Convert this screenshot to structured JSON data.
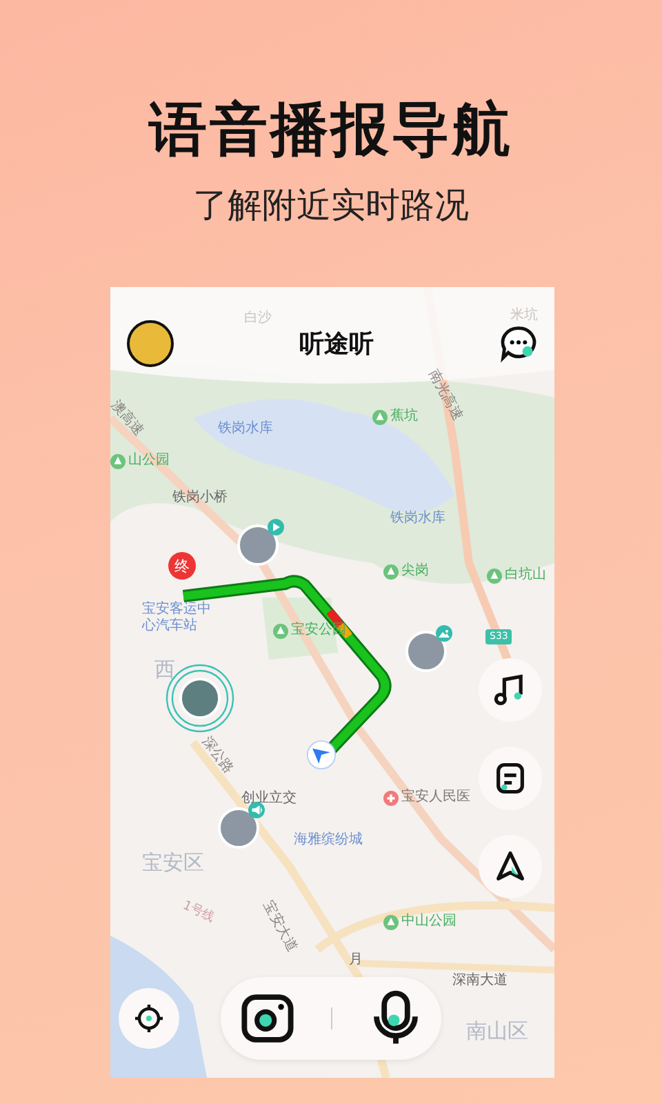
{
  "hero": {
    "title": "语音播报导航",
    "subtitle": "了解附近实时路况"
  },
  "app": {
    "title": "听途听"
  },
  "map": {
    "labels": [
      {
        "text": "白沙",
        "kind": "faint"
      },
      {
        "text": "米坑",
        "kind": "faint"
      },
      {
        "text": "澳高速",
        "kind": "road"
      },
      {
        "text": "铁岗水库",
        "kind": "water"
      },
      {
        "text": "蕉坑",
        "kind": "park"
      },
      {
        "text": "南光高速",
        "kind": "road"
      },
      {
        "text": "山公园",
        "kind": "park"
      },
      {
        "text": "铁岗小桥",
        "kind": "place"
      },
      {
        "text": "铁岗水库",
        "kind": "water"
      },
      {
        "text": "宝安客运中心汽车站",
        "kind": "water"
      },
      {
        "text": "宝安公园",
        "kind": "park"
      },
      {
        "text": "尖岗",
        "kind": "park"
      },
      {
        "text": "白坑山",
        "kind": "park"
      },
      {
        "text": "S33",
        "kind": "shield"
      },
      {
        "text": "西",
        "kind": "district"
      },
      {
        "text": "深公路",
        "kind": "road"
      },
      {
        "text": "创业立交",
        "kind": "place"
      },
      {
        "text": "宝安人民医",
        "kind": "hospital"
      },
      {
        "text": "海雅缤纷城",
        "kind": "water"
      },
      {
        "text": "宝安区",
        "kind": "district"
      },
      {
        "text": "1号线",
        "kind": "metro"
      },
      {
        "text": "宝安大道",
        "kind": "road"
      },
      {
        "text": "中山公园",
        "kind": "park"
      },
      {
        "text": "月",
        "kind": "place"
      },
      {
        "text": "深南大道",
        "kind": "place"
      },
      {
        "text": "南山区",
        "kind": "district"
      }
    ],
    "destination": {
      "label": "终"
    }
  },
  "posts": [
    {
      "kind": "play"
    },
    {
      "kind": "image"
    },
    {
      "kind": "live"
    },
    {
      "kind": "sound"
    }
  ]
}
